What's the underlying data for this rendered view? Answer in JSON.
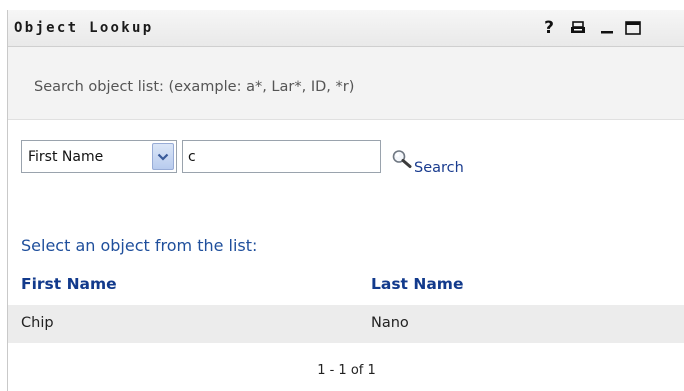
{
  "window": {
    "title": "Object Lookup",
    "help_label": "?",
    "icons": [
      "help-icon",
      "printer-icon",
      "minimize-icon",
      "maximize-icon"
    ]
  },
  "search": {
    "hint": "Search object list: (example: a*, Lar*, ID, *r)",
    "field_selected": "First Name",
    "query_value": "c",
    "button_label": "Search",
    "button_icon": "magnifier-icon"
  },
  "results": {
    "heading": "Select an object from the list:",
    "columns": [
      "First Name",
      "Last Name"
    ],
    "rows": [
      [
        "Chip",
        "Nano"
      ]
    ],
    "pager": "1 - 1 of 1"
  },
  "colors": {
    "link": "#1a3c8f",
    "heading": "#1f4f9c",
    "row_bg": "#ececec",
    "band_bg": "#f3f3f3"
  }
}
